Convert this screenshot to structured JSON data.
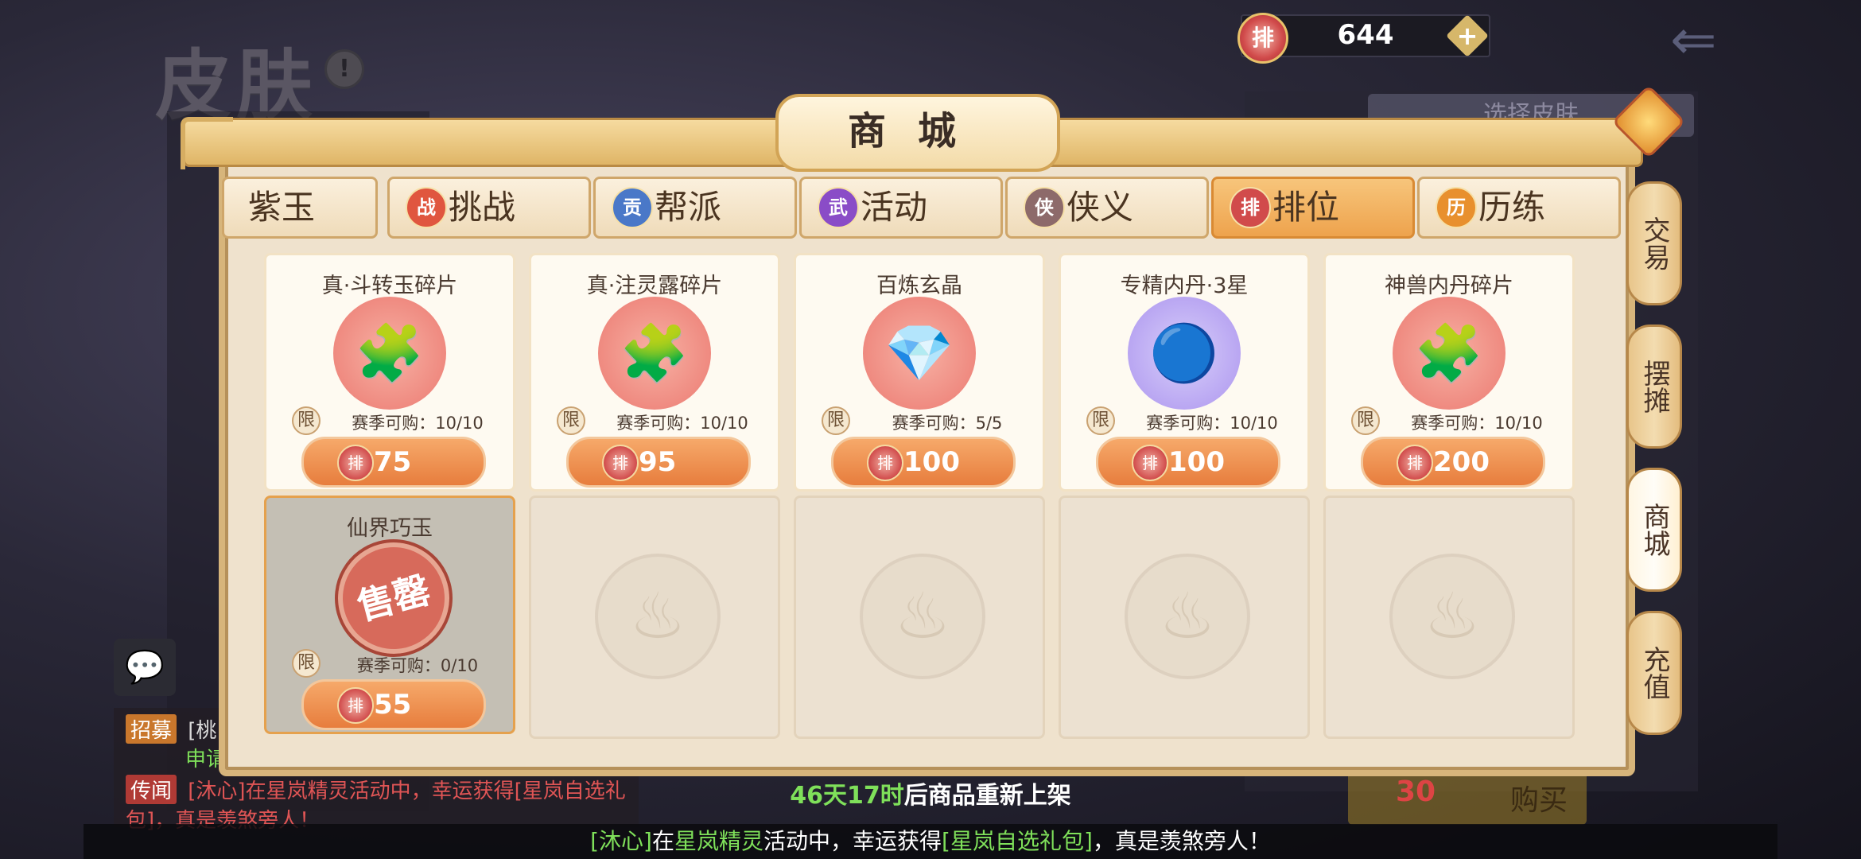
{
  "background": {
    "title": "皮肤",
    "right_button": "选择皮肤",
    "currency_coin": "排",
    "currency_amount": "644",
    "currency_plus": "+",
    "buy_count": "30",
    "buy_label": "购买"
  },
  "shop": {
    "title": "商城",
    "tabs": [
      {
        "label": "紫玉",
        "icon": ""
      },
      {
        "label": "挑战",
        "icon": "战"
      },
      {
        "label": "帮派",
        "icon": "贡"
      },
      {
        "label": "活动",
        "icon": "武"
      },
      {
        "label": "侠义",
        "icon": "侠"
      },
      {
        "label": "排位",
        "icon": "排"
      },
      {
        "label": "历练",
        "icon": "历"
      }
    ],
    "active_tab": "排位",
    "side_tabs": [
      "交易",
      "摆摊",
      "商城",
      "充值"
    ],
    "active_side_tab": "商城",
    "items": [
      {
        "name": "真·斗转玉碎片",
        "limit": "限",
        "quota": "赛季可购：10/10",
        "price_icon": "排",
        "price": "75"
      },
      {
        "name": "真·注灵露碎片",
        "limit": "限",
        "quota": "赛季可购：10/10",
        "price_icon": "排",
        "price": "95"
      },
      {
        "name": "百炼玄晶",
        "limit": "限",
        "quota": "赛季可购：5/5",
        "price_icon": "排",
        "price": "100"
      },
      {
        "name": "专精内丹·3星",
        "limit": "限",
        "quota": "赛季可购：10/10",
        "price_icon": "排",
        "price": "100"
      },
      {
        "name": "神兽内丹碎片",
        "limit": "限",
        "quota": "赛季可购：10/10",
        "price_icon": "排",
        "price": "200"
      },
      {
        "name": "仙界巧玉",
        "limit": "限",
        "quota": "赛季可购：0/10",
        "price_icon": "排",
        "price": "55",
        "sold_out": "售罄"
      }
    ]
  },
  "restock": {
    "time": "46天17时",
    "text": "后商品重新上架"
  },
  "chat": [
    {
      "tag": "招募",
      "text": "[桃"
    },
    {
      "tag": "",
      "text": "申请"
    },
    {
      "tag": "传闻",
      "text": "[沐心]在星岚精灵活动中，幸运获得[星岚自选礼包]，真是羡煞旁人！"
    }
  ],
  "ticker": {
    "p1": "[沐心]",
    "p2": "在",
    "p3": "星岚精灵",
    "p4": "活动中，幸运获得",
    "p5": "[星岚自选礼包]",
    "p6": "，真是羡煞旁人！"
  }
}
